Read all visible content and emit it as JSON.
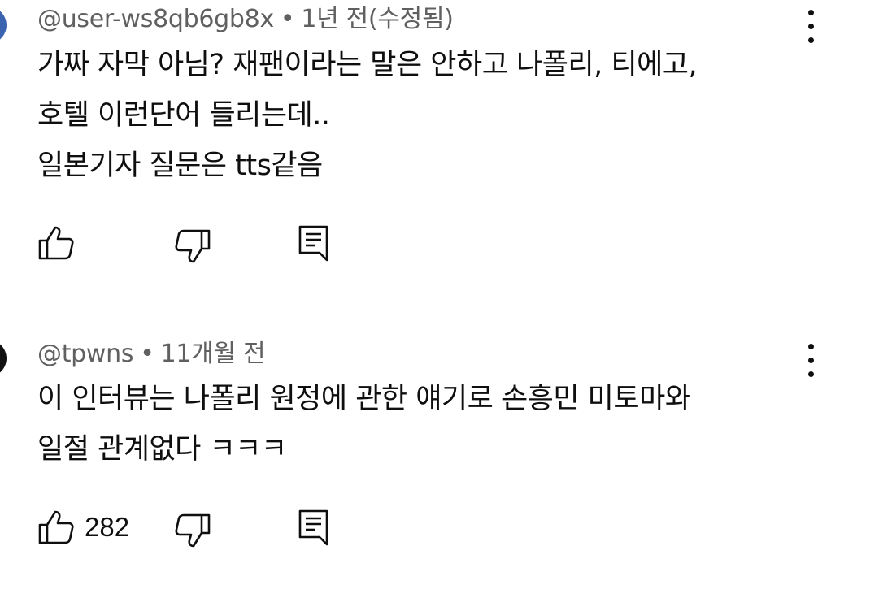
{
  "comments": [
    {
      "author": "@user-ws8qb6gb8x",
      "separator": "•",
      "time": "1년 전(수정됨)",
      "lines": [
        "가짜 자막 아님? 재팬이라는 말은 안하고 나폴리, 티에고,",
        "호텔 이런단어 들리는데..",
        "일본기자 질문은 tts같음"
      ],
      "like_count": "",
      "avatar_color": "#3a63b0"
    },
    {
      "author": "@tpwns",
      "separator": "•",
      "time": "11개월 전",
      "lines": [
        "이 인터뷰는 나폴리 원정에 관한 얘기로 손흥민 미토마와",
        "일절 관계없다 ㅋㅋㅋ"
      ],
      "like_count": "282",
      "avatar_color": "#111111"
    }
  ],
  "icons": {
    "like": "thumbs-up-icon",
    "dislike": "thumbs-down-icon",
    "reply": "reply-icon",
    "more": "more-vertical-icon"
  }
}
